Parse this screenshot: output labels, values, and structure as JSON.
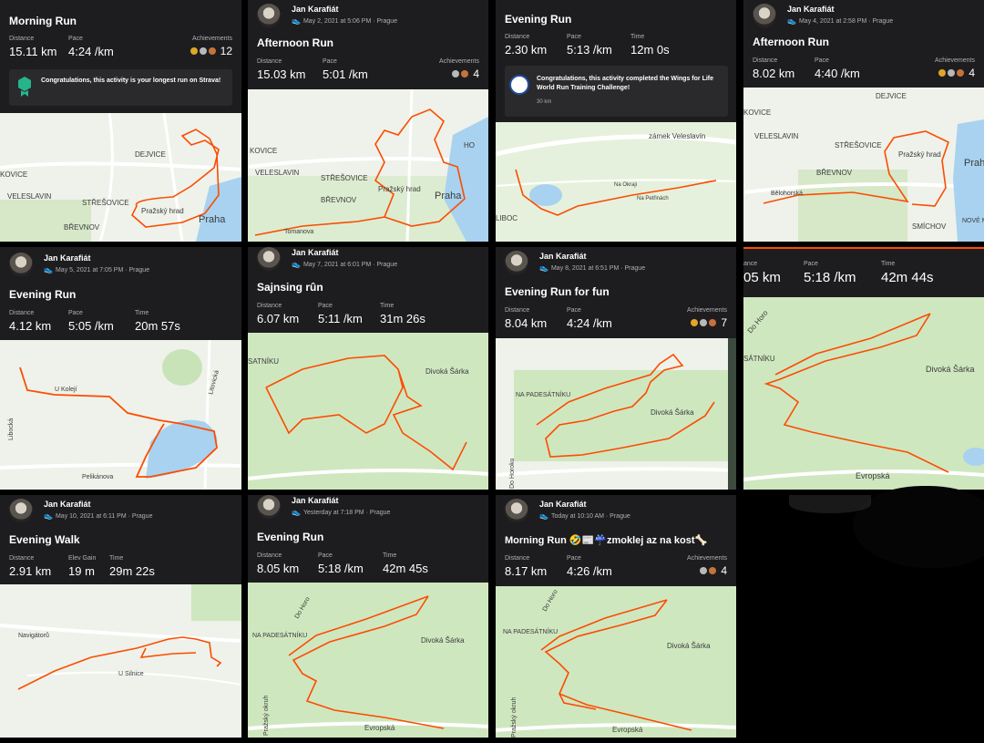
{
  "user": "Jan Karafiát",
  "cards": [
    {
      "meta": "",
      "title": "Morning Run",
      "stats": [
        {
          "label": "Distance",
          "value": "15.11 km"
        },
        {
          "label": "Pace",
          "value": "4:24 /km"
        }
      ],
      "ach": {
        "label": "Achievements",
        "count": "12"
      },
      "banner": "Congratulations, this activity is your longest run on Strava!",
      "map_labels": [
        "DEJVICE",
        "KOVICE",
        "VELESLAVIN",
        "STŘEŠOVICE",
        "BŘEVNOV",
        "Pražský hrad",
        "Praha"
      ]
    },
    {
      "meta": "May 2, 2021 at 5:06 PM · Prague",
      "title": "Afternoon Run",
      "stats": [
        {
          "label": "Distance",
          "value": "15.03 km"
        },
        {
          "label": "Pace",
          "value": "5:01 /km"
        }
      ],
      "ach": {
        "label": "Achievements",
        "count": "4"
      },
      "map_labels": [
        "KOVICE",
        "VELESLAVIN",
        "STŘEŠOVICE",
        "BŘEVNOV",
        "Pražský hrad",
        "Praha",
        "Tomanova",
        "HO"
      ]
    },
    {
      "meta": "",
      "title": "Evening Run",
      "stats": [
        {
          "label": "Distance",
          "value": "2.30 km"
        },
        {
          "label": "Pace",
          "value": "5:13 /km"
        },
        {
          "label": "Time",
          "value": "12m 0s"
        }
      ],
      "banner": "Congratulations, this activity completed the Wings for Life World Run Training Challenge!",
      "banner_sub": "30 km",
      "map_labels": [
        "zámek Veleslavín",
        "Na Okraji",
        "Na Petřinách",
        "LIBOC"
      ]
    },
    {
      "meta": "May 4, 2021 at 2:58 PM · Prague",
      "title": "Afternoon Run",
      "stats": [
        {
          "label": "Distance",
          "value": "8.02 km"
        },
        {
          "label": "Pace",
          "value": "4:40 /km"
        }
      ],
      "ach": {
        "label": "Achievements",
        "count": "4"
      },
      "map_labels": [
        "DEJVICE",
        "KOVICE",
        "VELESLAVIN",
        "STŘEŠOVICE",
        "BŘEVNOV",
        "Pražský hrad",
        "Bělohorská",
        "SMÍCHOV",
        "Prah",
        "NOVÉ MĚST"
      ]
    },
    {
      "meta": "May 5, 2021 at 7:05 PM · Prague",
      "title": "Evening Run",
      "stats": [
        {
          "label": "Distance",
          "value": "4.12 km"
        },
        {
          "label": "Pace",
          "value": "5:05 /km"
        },
        {
          "label": "Time",
          "value": "20m 57s"
        }
      ],
      "map_labels": [
        "U Kolejí",
        "Libocká",
        "Litovická",
        "Pelikánova"
      ]
    },
    {
      "meta": "May 7, 2021 at 6:01 PM · Prague",
      "title": "Sajnsing rûn",
      "stats": [
        {
          "label": "Distance",
          "value": "6.07 km"
        },
        {
          "label": "Pace",
          "value": "5:11 /km"
        },
        {
          "label": "Time",
          "value": "31m 26s"
        }
      ],
      "map_labels": [
        "Divoká Šárka",
        "SATNÍKU"
      ]
    },
    {
      "meta": "May 8, 2021 at 6:51 PM · Prague",
      "title": "Evening Run for fun",
      "stats": [
        {
          "label": "Distance",
          "value": "8.04 km"
        },
        {
          "label": "Pace",
          "value": "4:24 /km"
        }
      ],
      "ach": {
        "label": "Achievements",
        "count": "7"
      },
      "map_labels": [
        "NA PADESÁTNÍKU",
        "Divoká Šárka",
        "Do Horoku"
      ]
    },
    {
      "meta": "",
      "title": "",
      "stats": [
        {
          "label": "ance",
          "value": "05 km"
        },
        {
          "label": "Pace",
          "value": "5:18 /km"
        },
        {
          "label": "Time",
          "value": "42m 44s"
        }
      ],
      "map_labels": [
        "Do Horo",
        "SÁTNÍKU",
        "Divoká Šárka",
        "Evropská"
      ]
    },
    {
      "meta": "May 10, 2021 at 6:11 PM · Prague",
      "title": "Evening Walk",
      "stats": [
        {
          "label": "Distance",
          "value": "2.91 km"
        },
        {
          "label": "Elev Gain",
          "value": "19 m"
        },
        {
          "label": "Time",
          "value": "29m 22s"
        }
      ],
      "map_labels": [
        "Navigátorů",
        "U Silnice"
      ]
    },
    {
      "meta": "Yesterday at 7:18 PM · Prague",
      "title": "Evening Run",
      "stats": [
        {
          "label": "Distance",
          "value": "8.05 km"
        },
        {
          "label": "Pace",
          "value": "5:18 /km"
        },
        {
          "label": "Time",
          "value": "42m 45s"
        }
      ],
      "map_labels": [
        "Do Horo",
        "NA PADESÁTNÍKU",
        "Divoká Šárka",
        "Evropská",
        "Pražský okruh"
      ]
    },
    {
      "meta": "Today at 10:10 AM · Prague",
      "title": "Morning Run 🤣📰☔zmoklej az na kost🦴",
      "stats": [
        {
          "label": "Distance",
          "value": "8.17 km"
        },
        {
          "label": "Pace",
          "value": "4:26 /km"
        }
      ],
      "ach": {
        "label": "Achievements",
        "count": "4"
      },
      "map_labels": [
        "Do Horo",
        "NA PADESÁTNÍKU",
        "Divoká Šárka",
        "Evropská",
        "Pražský okruh"
      ]
    }
  ],
  "colors": {
    "route": "#fc4c02",
    "card": "#1d1d20",
    "map": "#eef2ea",
    "park": "#c8e3b8",
    "water": "#a8d2ef"
  }
}
